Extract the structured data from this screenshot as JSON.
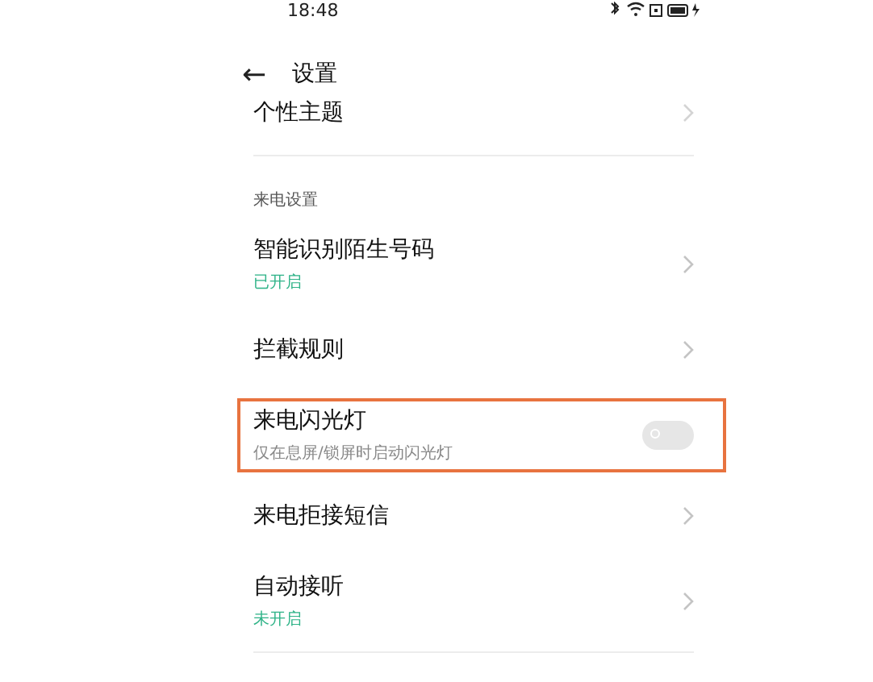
{
  "status_bar": {
    "time": "18:48"
  },
  "header": {
    "back": "←",
    "title": "设置"
  },
  "top_item": {
    "label": "个性主题"
  },
  "section": {
    "title": "来电设置"
  },
  "items": [
    {
      "kind": "link",
      "label": "智能识别陌生号码",
      "status": "已开启",
      "highlighted": false
    },
    {
      "kind": "link",
      "label": "拦截规则",
      "highlighted": false
    },
    {
      "kind": "toggle",
      "label": "来电闪光灯",
      "subtitle": "仅在息屏/锁屏时启动闪光灯",
      "on": false,
      "highlighted": true
    },
    {
      "kind": "link",
      "label": "来电拒接短信",
      "highlighted": false
    },
    {
      "kind": "link",
      "label": "自动接听",
      "status": "未开启",
      "highlighted": false
    }
  ]
}
